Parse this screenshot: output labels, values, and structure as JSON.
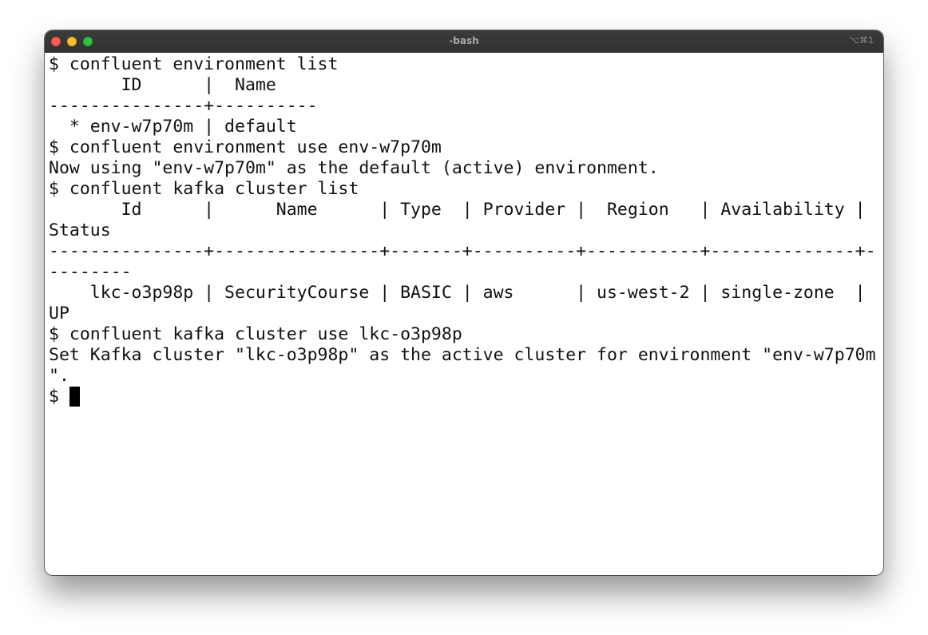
{
  "window": {
    "title": "-bash",
    "shortcut": "⌥⌘1"
  },
  "terminal": {
    "lines": [
      "$ confluent environment list",
      "       ID      |  Name",
      "---------------+----------",
      "  * env-w7p70m | default",
      "$ confluent environment use env-w7p70m",
      "Now using \"env-w7p70m\" as the default (active) environment.",
      "$ confluent kafka cluster list",
      "       Id      |      Name      | Type  | Provider |  Region   | Availability |",
      "Status",
      "---------------+----------------+-------+----------+-----------+--------------+-",
      "--------",
      "    lkc-o3p98p | SecurityCourse | BASIC | aws      | us-west-2 | single-zone  |",
      "UP",
      "$ confluent kafka cluster use lkc-o3p98p",
      "Set Kafka cluster \"lkc-o3p98p\" as the active cluster for environment \"env-w7p70m",
      "\"."
    ],
    "prompt": "$ "
  },
  "colors": {
    "titlebar": "#363636",
    "close": "#fe5f57",
    "minimize": "#febc2e",
    "zoom": "#28c840",
    "text": "#111111",
    "background": "#ffffff"
  }
}
